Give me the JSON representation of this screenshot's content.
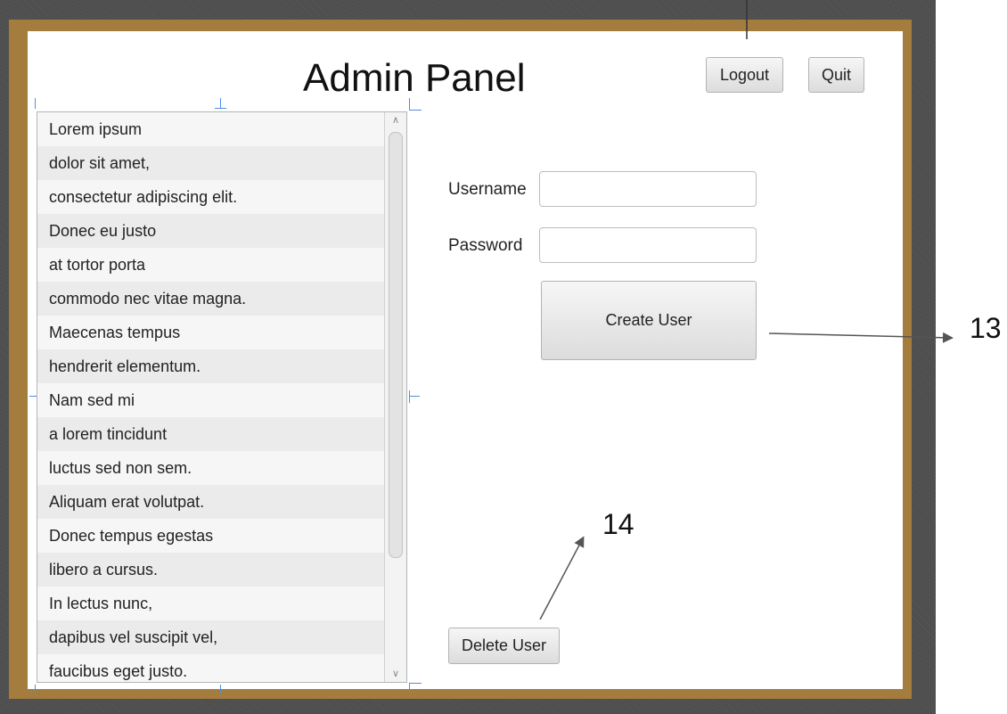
{
  "window": {
    "title": "Admin Panel",
    "logout_label": "Logout",
    "quit_label": "Quit"
  },
  "user_list": {
    "items": [
      "Lorem ipsum",
      "dolor sit amet,",
      "consectetur adipiscing elit.",
      "Donec eu justo",
      "at tortor porta",
      "commodo nec vitae magna.",
      "Maecenas tempus",
      "hendrerit elementum.",
      "Nam sed mi",
      "a lorem tincidunt",
      "luctus sed non sem.",
      "Aliquam erat volutpat.",
      "Donec tempus egestas",
      "libero a cursus.",
      "In lectus nunc,",
      "dapibus vel suscipit vel,",
      "faucibus eget justo."
    ]
  },
  "form": {
    "username_label": "Username",
    "username_value": "",
    "password_label": "Password",
    "password_value": "",
    "create_label": "Create User",
    "delete_label": "Delete User"
  },
  "annotations": {
    "label_13": "13",
    "label_14": "14"
  },
  "colors": {
    "frame": "#a47d3e",
    "background": "#4d4d4d",
    "guide": "#4a90e2"
  }
}
